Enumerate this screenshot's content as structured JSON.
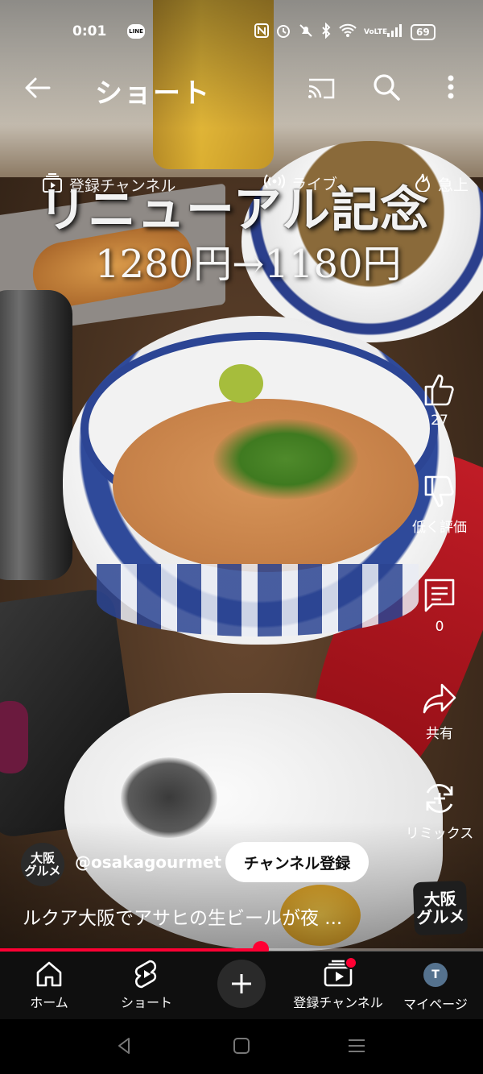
{
  "status_bar": {
    "time": "0:01",
    "line_app_label": "LINE",
    "battery": "69",
    "network_label": "VoLTE"
  },
  "app_bar": {
    "title": "ショート"
  },
  "feed_tabs": [
    {
      "label": "登録チャンネル"
    },
    {
      "label": "ライブ"
    },
    {
      "label": "急上"
    }
  ],
  "video_caption": {
    "line1": "リニューアル記念",
    "line2": "1280円→1180円"
  },
  "actions": {
    "like_count": "27",
    "dislike_label": "低く評価",
    "comment_count": "0",
    "share_label": "共有",
    "remix_label": "リミックス"
  },
  "channel": {
    "avatar_text": "大阪グルメ",
    "avatar_line1": "大阪",
    "avatar_line2": "グルメ",
    "handle": "@osakagourmet",
    "subscribe_label": "チャンネル登録"
  },
  "description": "ルクア大阪でアサヒの生ビールが夜 ...",
  "progress": 0.54,
  "bottom_nav": [
    {
      "label": "ホーム"
    },
    {
      "label": "ショート"
    },
    {
      "label": ""
    },
    {
      "label": "登録チャンネル"
    },
    {
      "label": "マイページ"
    }
  ],
  "my_avatar_initial": "T",
  "colors": {
    "accent": "#ff0033",
    "nav_background": "#0f0f0f",
    "subscribe_background": "#ffffff"
  }
}
